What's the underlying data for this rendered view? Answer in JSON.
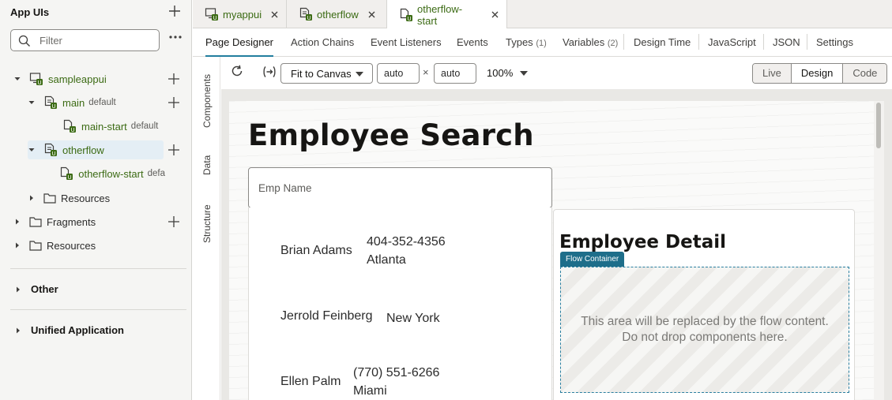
{
  "left_panel": {
    "title": "App UIs",
    "filter_placeholder": "Filter",
    "tree": {
      "sampleappui": "sampleappui",
      "main": "main",
      "main_suffix": "default",
      "main_start": "main-start",
      "main_start_suffix": "default",
      "otherflow": "otherflow",
      "otherflow_start": "otherflow-start",
      "otherflow_start_suffix": "defa",
      "resources_inner": "Resources",
      "fragments": "Fragments",
      "resources": "Resources"
    },
    "sections": {
      "other": "Other",
      "unified": "Unified Application"
    }
  },
  "file_tabs": [
    {
      "label": "myappui",
      "active": false
    },
    {
      "label": "otherflow",
      "active": false
    },
    {
      "label": "otherflow-start",
      "active": true
    }
  ],
  "designer_tabs": {
    "page_designer": "Page Designer",
    "action_chains": "Action Chains",
    "event_listeners": "Event Listeners",
    "events": "Events",
    "types": "Types",
    "types_count": "(1)",
    "variables": "Variables",
    "variables_count": "(2)",
    "design_time": "Design Time",
    "javascript": "JavaScript",
    "json": "JSON",
    "settings": "Settings"
  },
  "vertical_tabs": {
    "components": "Components",
    "data": "Data",
    "structure": "Structure"
  },
  "toolbar": {
    "fit_select": "Fit to Canvas",
    "width_value": "auto",
    "times": "×",
    "height_value": "auto",
    "zoom": "100%",
    "modes": {
      "live": "Live",
      "design": "Design",
      "code": "Code"
    }
  },
  "canvas": {
    "page_title": "Employee Search",
    "emp_input_placeholder": "Emp Name",
    "employees": [
      {
        "name": "Brian Adams",
        "phone": "404-352-4356",
        "city": "Atlanta"
      },
      {
        "name": "Jerrold Feinberg",
        "phone": "",
        "city": "New York"
      },
      {
        "name": "Ellen Palm",
        "phone": "(770) 551-6266",
        "city": "Miami"
      }
    ],
    "detail_title": "Employee Detail",
    "flow_badge": "Flow Container",
    "flow_line1": "This area will be replaced by the flow content.",
    "flow_line2": "Do not drop components here."
  },
  "colors": {
    "accent_green": "#3c6b14",
    "tab_underline": "#227e9e",
    "flow_badge": "#1e6e8a"
  }
}
